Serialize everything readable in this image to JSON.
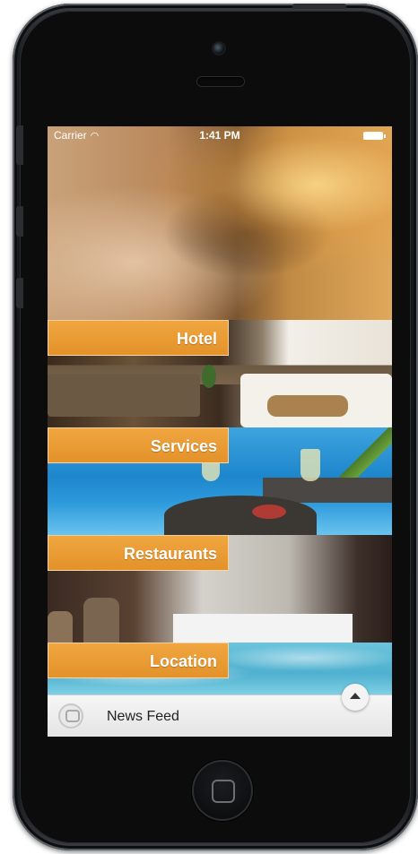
{
  "status_bar": {
    "carrier": "Carrier",
    "time": "1:41 PM",
    "wifi_icon": "wifi-icon",
    "battery_icon": "battery-icon"
  },
  "menu": [
    {
      "id": "hotel",
      "label": "Hotel"
    },
    {
      "id": "services",
      "label": "Services"
    },
    {
      "id": "restaurants",
      "label": "Restaurants"
    },
    {
      "id": "location",
      "label": "Location"
    }
  ],
  "news_feed": {
    "label": "News Feed",
    "icon": "chat-bubble-icon",
    "expand_icon": "chevron-up-icon"
  },
  "colors": {
    "accent": "#e8972f",
    "bar_bg": "#eeeeee"
  }
}
